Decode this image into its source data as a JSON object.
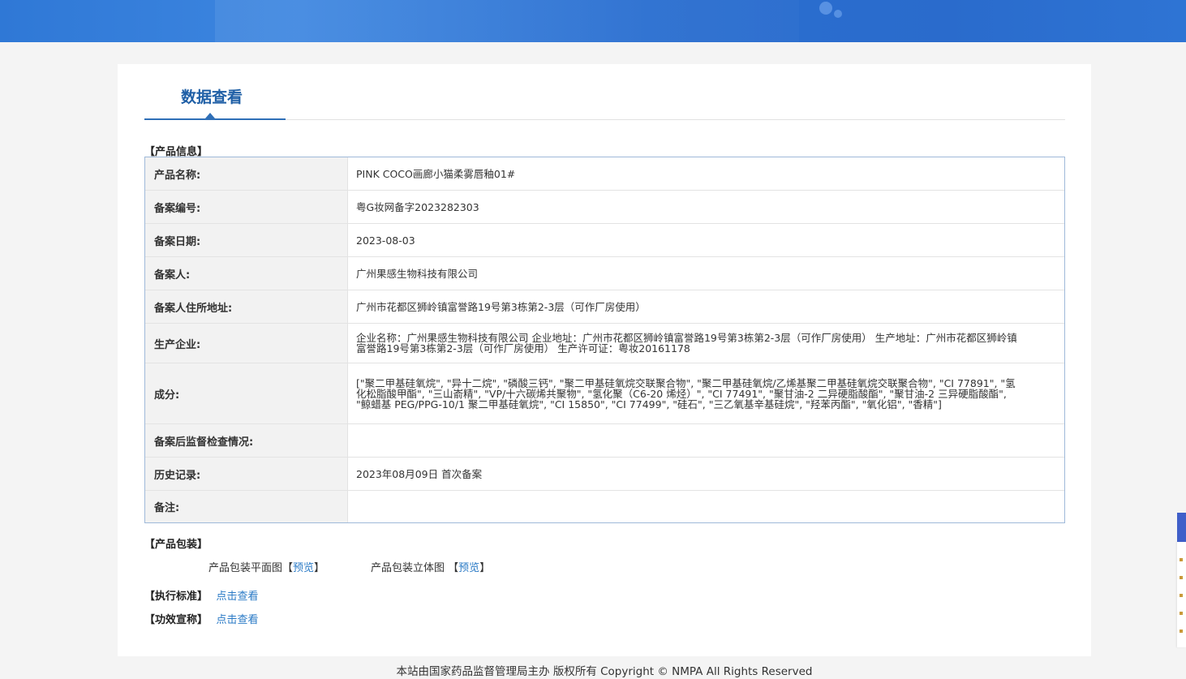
{
  "header": {},
  "tab": {
    "title": "数据查看"
  },
  "sections": {
    "product_info": "【产品信息】",
    "product_package": "【产品包装】",
    "standard": "【执行标准】",
    "claims": "【功效宣称】"
  },
  "product_info": {
    "rows": [
      {
        "key": "产品名称:",
        "value": "PINK COCO画廊小猫柔雾唇釉01#"
      },
      {
        "key": "备案编号:",
        "value": "粤G妆网备字2023282303"
      },
      {
        "key": "备案日期:",
        "value": "2023-08-03"
      },
      {
        "key": "备案人:",
        "value": "广州果感生物科技有限公司"
      },
      {
        "key": "备案人住所地址:",
        "value": "广州市花都区狮岭镇富誉路19号第3栋第2-3层（可作厂房使用）"
      },
      {
        "key": "生产企业:",
        "value": "企业名称：广州果感生物科技有限公司 企业地址：广州市花都区狮岭镇富誉路19号第3栋第2-3层（可作厂房使用） 生产地址：广州市花都区狮岭镇富誉路19号第3栋第2-3层（可作厂房使用） 生产许可证：粤妆20161178"
      },
      {
        "key": "成分:",
        "value": "[\"聚二甲基硅氧烷\", \"异十二烷\", \"磷酸三钙\", \"聚二甲基硅氧烷交联聚合物\", \"聚二甲基硅氧烷/乙烯基聚二甲基硅氧烷交联聚合物\", \"CI 77891\", \"氢化松脂酸甲酯\", \"三山嵛精\", \"VP/十六碳烯共聚物\", \"氢化聚（C6-20 烯烃）\", \"CI 77491\", \"聚甘油-2 二异硬脂酸酯\", \"聚甘油-2 三异硬脂酸酯\", \"鲸蜡基 PEG/PPG-10/1 聚二甲基硅氧烷\", \"CI 15850\", \"CI 77499\", \"硅石\", \"三乙氧基辛基硅烷\", \"羟苯丙酯\", \"氧化铝\", \"香精\"]"
      },
      {
        "key": "备案后监督检查情况:",
        "value": ""
      },
      {
        "key": "历史记录:",
        "value": "2023年08月09日 首次备案"
      },
      {
        "key": "备注:",
        "value": ""
      }
    ]
  },
  "package": {
    "flat_label": "产品包装平面图",
    "flat_bracket_open": "【",
    "flat_link": "预览",
    "flat_bracket_close": "】",
    "solid_label": "产品包装立体图",
    "solid_bracket_open": "【",
    "solid_link": "预览",
    "solid_bracket_close": "】"
  },
  "standard_link": "点击查看",
  "claims_link": "点击查看",
  "footer": {
    "text": "本站由国家药品监督管理局主办 版权所有 Copyright © NMPA All Rights Reserved"
  },
  "colors": {
    "accent": "#2f6fb7",
    "link": "#2a7ac6",
    "header": "#2e74d4"
  }
}
